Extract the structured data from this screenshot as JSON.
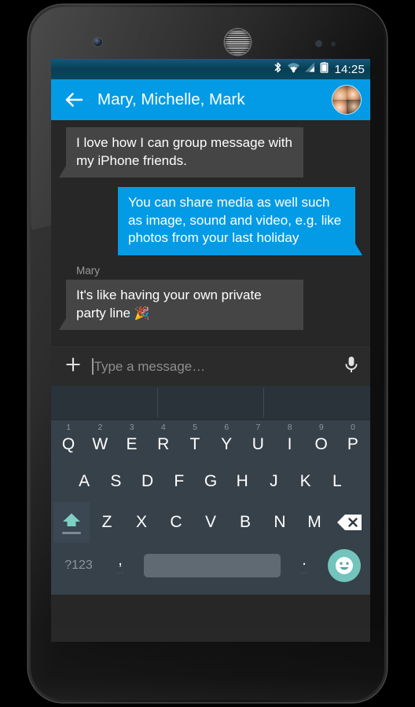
{
  "device": {
    "name": "android-smartphone",
    "components": [
      "front-camera",
      "earpiece-speaker",
      "proximity-sensor",
      "light-sensor"
    ]
  },
  "status_bar": {
    "time": "14:25",
    "icons": [
      "bluetooth-icon",
      "wifi-icon",
      "cellular-signal-icon",
      "battery-icon"
    ],
    "background": "#0a4a64"
  },
  "app_bar": {
    "back_label": "back-arrow-icon",
    "title": "Mary, Michelle, Mark",
    "avatar_label": "group-avatar",
    "background": "#039BE5"
  },
  "chat": {
    "background": "#272727",
    "messages": [
      {
        "direction": "incoming",
        "sender": "",
        "text": "I love how I can group message with my iPhone friends.",
        "bubble_color": "#454545"
      },
      {
        "direction": "outgoing",
        "sender": "",
        "text": "You can share media as well such as image, sound and video, e.g. like photos from your last holiday",
        "bubble_color": "#039BE5"
      },
      {
        "direction": "incoming",
        "sender": "Mary",
        "text": "It's like having your own private party line ",
        "emoji": "🎉",
        "bubble_color": "#454545"
      }
    ]
  },
  "composer": {
    "attach_label": "plus-icon",
    "value": "",
    "placeholder": "Type a message…",
    "mic_label": "microphone-icon"
  },
  "keyboard": {
    "background": "#36414a",
    "accent": "#72c4bc",
    "suggestion_strip": {
      "suggestions": [
        "",
        "",
        ""
      ]
    },
    "row_qwerty": [
      {
        "key": "Q",
        "num": "1"
      },
      {
        "key": "W",
        "num": "2"
      },
      {
        "key": "E",
        "num": "3"
      },
      {
        "key": "R",
        "num": "4"
      },
      {
        "key": "T",
        "num": "5"
      },
      {
        "key": "Y",
        "num": "6"
      },
      {
        "key": "U",
        "num": "7"
      },
      {
        "key": "I",
        "num": "8"
      },
      {
        "key": "O",
        "num": "9"
      },
      {
        "key": "P",
        "num": "0"
      }
    ],
    "row_home": [
      "A",
      "S",
      "D",
      "F",
      "G",
      "H",
      "J",
      "K",
      "L"
    ],
    "row_shift": {
      "shift_label": "shift-icon",
      "letters": [
        "Z",
        "X",
        "C",
        "V",
        "B",
        "N",
        "M"
      ],
      "backspace_label": "backspace-icon"
    },
    "row_space": {
      "symbols_label": "?123",
      "comma": ",",
      "comma_hint": "···",
      "space_label": "space-bar",
      "period": ".",
      "period_hint": "···",
      "emoji_label": "emoji-smiley-icon"
    }
  }
}
